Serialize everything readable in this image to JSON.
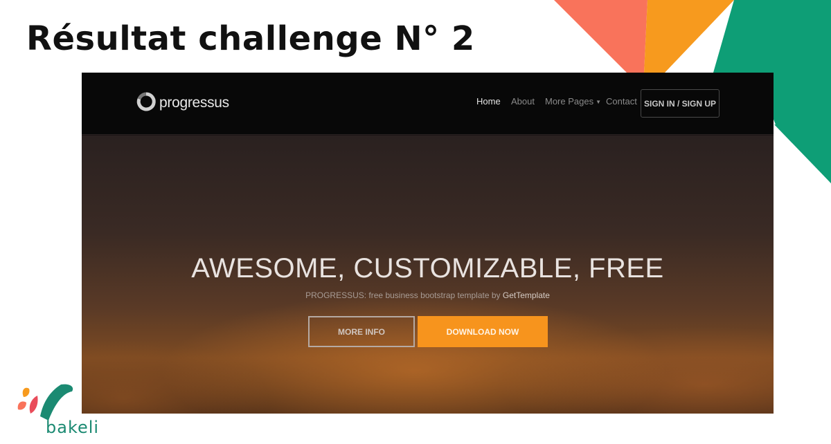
{
  "slide": {
    "title": "Résultat challenge N° 2"
  },
  "site": {
    "brand": "progressus",
    "nav": [
      {
        "label": "Home",
        "active": true
      },
      {
        "label": "About",
        "active": false
      },
      {
        "label": "More Pages",
        "active": false,
        "dropdown": true
      },
      {
        "label": "Contact",
        "active": false
      }
    ],
    "signin_label": "SIGN IN / SIGN UP",
    "hero": {
      "title": "AWESOME, CUSTOMIZABLE, FREE",
      "subtitle_prefix": "PROGRESSUS: free business bootstrap template by ",
      "subtitle_brand": "GetTemplate",
      "more_info_label": "MORE INFO",
      "download_label": "DOWNLOAD NOW"
    }
  },
  "logo": {
    "name": "bakeli"
  },
  "colors": {
    "accent_orange": "#f7941d",
    "corner_coral": "#f9735b",
    "corner_orange": "#f79a1e",
    "corner_green": "#0e9e76",
    "bakeli_green": "#1b8a72"
  }
}
